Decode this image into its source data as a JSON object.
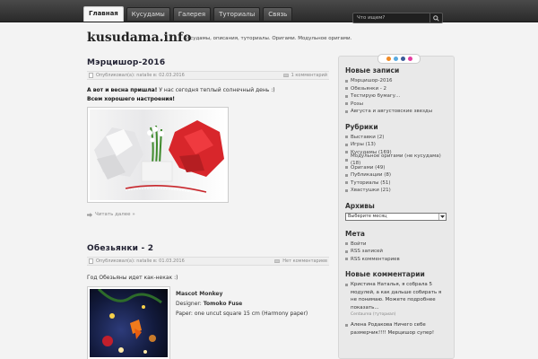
{
  "nav": {
    "tabs": [
      "Главная",
      "Кусудамы",
      "Галерея",
      "Туториалы",
      "Связь"
    ],
    "active": 0
  },
  "search": {
    "placeholder": "Что ищем?"
  },
  "header": {
    "title": "kusudama.info",
    "description": "Кусудамы, описания, туториалы. Оригами. Модульное оригами."
  },
  "posts": [
    {
      "title": "Мэрцишор-2016",
      "meta_author": "Опубликовал(а): natalie в: 02.03.2016",
      "comments": "1 комментарий",
      "line1_bold": "А вот и весна пришла!",
      "line1_rest": " У нас сегодня теплый солнечный день :)",
      "line2": "Всем хорошего настроения!",
      "readmore": "Читать далее »"
    },
    {
      "title": "Обезьянки - 2",
      "meta_author": "Опубликовал(а): natalie в: 01.03.2016",
      "comments": "Нет комментариев",
      "intro": "Год Обезьяны идет как-некак :)",
      "model_title": "Mascot Monkey",
      "designer_label": "Designer: ",
      "designer": "Tomoko Fuse",
      "paper": "Paper: one uncut square 15 cm (Harmony paper)"
    }
  ],
  "sidebar": {
    "recent_title": "Новые записи",
    "recent": [
      "Мэрцишор-2016",
      "Обезьянки - 2",
      "Тестирую бумагу...",
      "Розы",
      "Августа и августовские звезды"
    ],
    "categories_title": "Рубрики",
    "categories": [
      "Выставки (2)",
      "Игры (13)",
      "Кусудамы (169)",
      "Модульное оригами (не кусудама) (18)",
      "Оригами (49)",
      "Публикации (8)",
      "Туториалы (51)",
      "Хвастушки (21)"
    ],
    "archives_title": "Архивы",
    "archive_select": "Выберите месяц",
    "meta_title": "Мета",
    "meta_links": [
      "Войти",
      "RSS записей",
      "RSS комментариев"
    ],
    "comments_title": "Новые комментарии",
    "comment1": "Кристина Наталья, я собрала 5 модулей, а как дальше собирать я не понимаю. Можете подробнее показать...",
    "comment1_sub": "Centaurea (туториал)",
    "comment2": "Алена Родакова Ничего себе размерчик!!!! Мерцишор супер!"
  },
  "colors": {
    "accent": "#b0272b",
    "nav_bg": "#333333",
    "sidebar_bg": "#e9e9e9"
  }
}
